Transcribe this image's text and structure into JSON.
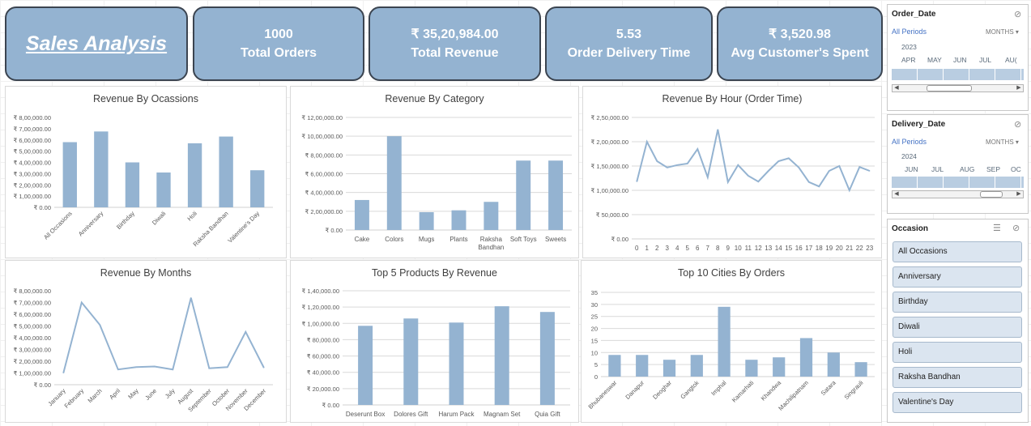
{
  "kpis": {
    "title": "Sales Analysis",
    "orders_value": "1000",
    "orders_label": "Total Orders",
    "revenue_value": "₹ 35,20,984.00",
    "revenue_label": "Total Revenue",
    "delivery_value": "5.53",
    "delivery_label": "Order Delivery Time",
    "avg_value": "₹ 3,520.98",
    "avg_label": "Avg Customer's Spent"
  },
  "colors": {
    "bar": "#94b3d1",
    "kpi_bg": "#94b3d1",
    "kpi_border": "#3b4450",
    "slicer_btn": "#dbe5f0",
    "link": "#4472c4"
  },
  "order_date_slicer": {
    "title": "Order_Date",
    "periods": "All Periods",
    "level": "MONTHS",
    "year": "2023",
    "months": [
      "APR",
      "MAY",
      "JUN",
      "JUL",
      "AU("
    ]
  },
  "delivery_date_slicer": {
    "title": "Delivery_Date",
    "periods": "All Periods",
    "level": "MONTHS",
    "year": "2024",
    "months": [
      "JUN",
      "JUL",
      "AUG",
      "SEP",
      "OC"
    ]
  },
  "occasion_slicer": {
    "title": "Occasion",
    "items": [
      "All Occasions",
      "Anniversary",
      "Birthday",
      "Diwali",
      "Holi",
      "Raksha Bandhan",
      "Valentine's Day"
    ]
  },
  "chart_data": [
    {
      "id": "occasions",
      "type": "bar",
      "title": "Revenue By Ocassions",
      "categories": [
        "All Occasions",
        "Anniversary",
        "Birthday",
        "Diwali",
        "Holi",
        "Raksha Bandhan",
        "Valentine's Day"
      ],
      "values": [
        580000,
        675000,
        400000,
        310000,
        570000,
        630000,
        330000
      ],
      "ylim": [
        0,
        800000
      ],
      "yticks": [
        "₹ 0.00",
        "₹ 1,00,000.00",
        "₹ 2,00,000.00",
        "₹ 3,00,000.00",
        "₹ 4,00,000.00",
        "₹ 5,00,000.00",
        "₹ 6,00,000.00",
        "₹ 7,00,000.00",
        "₹ 8,00,000.00"
      ],
      "grid": false
    },
    {
      "id": "category",
      "type": "bar",
      "title": "Revenue By Category",
      "categories": [
        "Cake",
        "Colors",
        "Mugs",
        "Plants",
        "Raksha Bandhan",
        "Soft Toys",
        "Sweets"
      ],
      "category_lines": [
        [
          "Cake"
        ],
        [
          "Colors"
        ],
        [
          "Mugs"
        ],
        [
          "Plants"
        ],
        [
          "Raksha",
          "Bandhan"
        ],
        [
          "Soft Toys"
        ],
        [
          "Sweets"
        ]
      ],
      "values": [
        320000,
        1000000,
        190000,
        210000,
        300000,
        740000,
        740000
      ],
      "ylim": [
        0,
        1200000
      ],
      "yticks": [
        "₹ 0.00",
        "₹ 2,00,000.00",
        "₹ 4,00,000.00",
        "₹ 6,00,000.00",
        "₹ 8,00,000.00",
        "₹ 10,00,000.00",
        "₹ 12,00,000.00"
      ],
      "grid": true
    },
    {
      "id": "hour",
      "type": "line",
      "title": "Revenue By Hour (Order Time)",
      "categories": [
        "0",
        "1",
        "2",
        "3",
        "4",
        "5",
        "6",
        "7",
        "8",
        "9",
        "10",
        "11",
        "12",
        "13",
        "14",
        "15",
        "16",
        "17",
        "18",
        "19",
        "20",
        "21",
        "22",
        "23"
      ],
      "values": [
        118000,
        200000,
        160000,
        147000,
        152000,
        155000,
        185000,
        127000,
        225000,
        117000,
        152000,
        130000,
        118000,
        140000,
        160000,
        166000,
        147000,
        117000,
        108000,
        140000,
        150000,
        100000,
        148000,
        140000
      ],
      "ylim": [
        0,
        250000
      ],
      "yticks": [
        "₹ 0.00",
        "₹ 50,000.00",
        "₹ 1,00,000.00",
        "₹ 1,50,000.00",
        "₹ 2,00,000.00",
        "₹ 2,50,000.00"
      ],
      "grid": true
    },
    {
      "id": "months",
      "type": "line",
      "title": "Revenue By Months",
      "categories": [
        "January",
        "February",
        "March",
        "April",
        "May",
        "June",
        "July",
        "August",
        "September",
        "October",
        "November",
        "December"
      ],
      "values": [
        100000,
        700000,
        510000,
        130000,
        150000,
        155000,
        130000,
        740000,
        140000,
        150000,
        450000,
        145000
      ],
      "ylim": [
        0,
        800000
      ],
      "yticks": [
        "₹ 0.00",
        "₹ 1,00,000.00",
        "₹ 2,00,000.00",
        "₹ 3,00,000.00",
        "₹ 4,00,000.00",
        "₹ 5,00,000.00",
        "₹ 6,00,000.00",
        "₹ 7,00,000.00",
        "₹ 8,00,000.00"
      ],
      "grid": false
    },
    {
      "id": "products",
      "type": "bar",
      "title": "Top 5 Products By Revenue",
      "categories": [
        "Deserunt Box",
        "Dolores Gift",
        "Harum Pack",
        "Magnam Set",
        "Quia Gift"
      ],
      "values": [
        97000,
        106000,
        101000,
        121000,
        114000
      ],
      "ylim": [
        0,
        140000
      ],
      "yticks": [
        "₹ 0.00",
        "₹ 20,000.00",
        "₹ 40,000.00",
        "₹ 60,000.00",
        "₹ 80,000.00",
        "₹ 1,00,000.00",
        "₹ 1,20,000.00",
        "₹ 1,40,000.00"
      ],
      "grid": true
    },
    {
      "id": "cities",
      "type": "bar",
      "title": "Top 10 Cities By Orders",
      "categories": [
        "Bhubaneswar",
        "Danapur",
        "Deoghar",
        "Gangtok",
        "Imphal",
        "Kamarhati",
        "Khandwa",
        "Machilipatnam",
        "Satara",
        "Singrauli"
      ],
      "values": [
        9,
        9,
        7,
        9,
        29,
        7,
        8,
        16,
        10,
        6
      ],
      "ylim": [
        0,
        35
      ],
      "yticks": [
        "0",
        "5",
        "10",
        "15",
        "20",
        "25",
        "30",
        "35"
      ],
      "grid": true
    }
  ]
}
